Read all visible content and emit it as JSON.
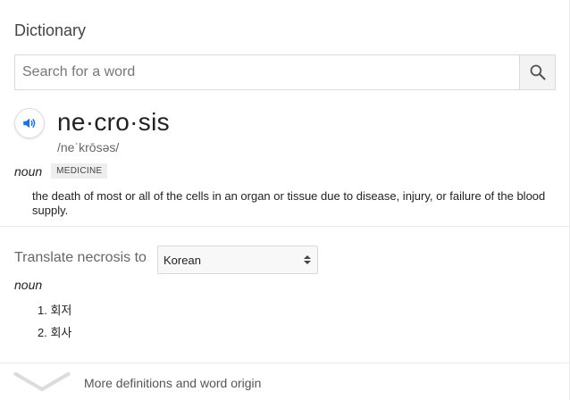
{
  "header": {
    "title": "Dictionary"
  },
  "search": {
    "placeholder": "Search for a word",
    "value": ""
  },
  "entry": {
    "headword": "ne·cro·sis",
    "phonetic": "/neˈkrōsəs/",
    "part_of_speech": "noun",
    "domain_tag": "MEDICINE",
    "definition": "the death of most or all of the cells in an organ or tissue due to disease, injury, or failure of the blood supply."
  },
  "translate": {
    "label": "Translate necrosis to",
    "selected_language": "Korean",
    "part_of_speech": "noun",
    "items": [
      "1. 회저",
      "2. 회사"
    ]
  },
  "footer": {
    "more_label": "More definitions and word origin"
  },
  "colors": {
    "accent_blue": "#1a73e8",
    "divider": "#ebebeb",
    "tag_bg": "#eeeeee"
  },
  "icons": {
    "search": "search-icon",
    "speaker": "speaker-icon",
    "select": "updown-arrows-icon",
    "expand": "chevron-down-icon"
  }
}
